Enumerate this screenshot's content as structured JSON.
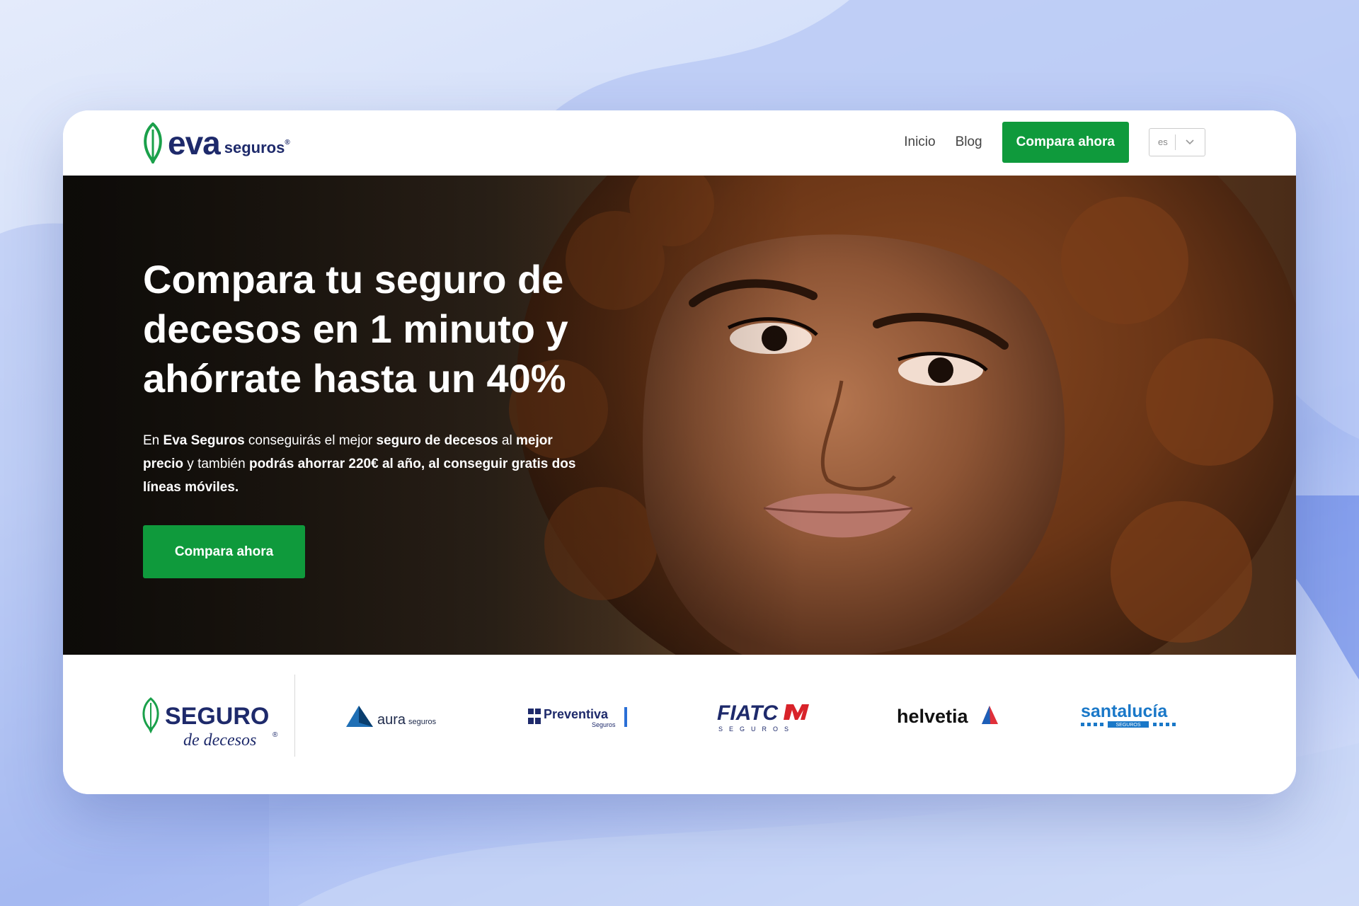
{
  "brand": {
    "name": "eva",
    "suffix": "seguros",
    "reg": "®",
    "green": "#0f9a3c",
    "navy": "#1e2a6b"
  },
  "nav": {
    "links": [
      "Inicio",
      "Blog"
    ],
    "cta": "Compara ahora",
    "language": "es",
    "language_icon": "chevron-down-icon"
  },
  "hero": {
    "title": "Compara tu seguro de decesos en 1 minuto y ahórrate hasta un 40%",
    "text": {
      "t1": "En ",
      "b1": "Eva Seguros",
      "t2": " conseguirás el mejor ",
      "b2": "seguro de decesos",
      "t3": " al ",
      "b3": "mejor precio",
      "t4": " y también ",
      "b4": "podrás ahorrar 220€ al año, al conseguir gratis dos líneas móviles."
    },
    "cta": "Compara ahora"
  },
  "partners": {
    "main_logo": {
      "line1": "SEGURO",
      "line2": "de decesos",
      "reg": "®"
    },
    "logos": [
      {
        "name": "aura",
        "sub": "seguros"
      },
      {
        "name": "Preventiva",
        "sub": "Seguros"
      },
      {
        "name": "FIATC",
        "sub": "SEGUROS"
      },
      {
        "name": "helvetia"
      },
      {
        "name": "santalucía",
        "sub": "SEGUROS"
      }
    ]
  }
}
